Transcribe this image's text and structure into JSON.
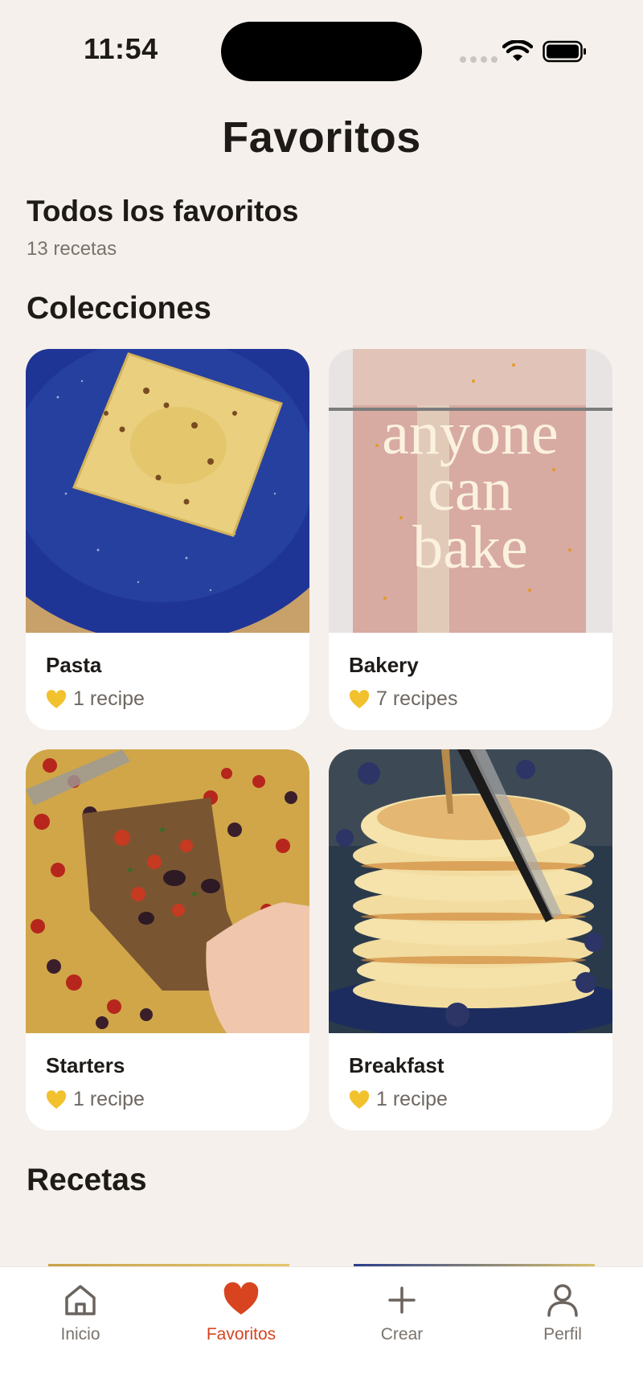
{
  "status_bar": {
    "time": "11:54"
  },
  "header": {
    "title": "Favoritos"
  },
  "all_favorites": {
    "title": "Todos los favoritos",
    "count": "13 recetas"
  },
  "sections": {
    "collections": "Colecciones",
    "recipes": "Recetas"
  },
  "collections": [
    {
      "name": "Pasta",
      "count": "1 recipe",
      "image": "ravioli-photo"
    },
    {
      "name": "Bakery",
      "count": "7 recipes",
      "image": "anyone-can-bake-photo",
      "image_text": "anyone can bake"
    },
    {
      "name": "Starters",
      "count": "1 recipe",
      "image": "tomato-olive-toast-photo"
    },
    {
      "name": "Breakfast",
      "count": "1 recipe",
      "image": "pancakes-photo"
    }
  ],
  "bottom_nav": {
    "items": [
      {
        "label": "Inicio",
        "icon": "home-icon",
        "active": false
      },
      {
        "label": "Favoritos",
        "icon": "heart-icon",
        "active": true
      },
      {
        "label": "Crear",
        "icon": "plus-icon",
        "active": false
      },
      {
        "label": "Perfil",
        "icon": "person-icon",
        "active": false
      }
    ]
  },
  "colors": {
    "background": "#f5f0eb",
    "accent": "#d8441f",
    "heart_yellow": "#f2c12e",
    "muted_text": "#7a736c"
  }
}
